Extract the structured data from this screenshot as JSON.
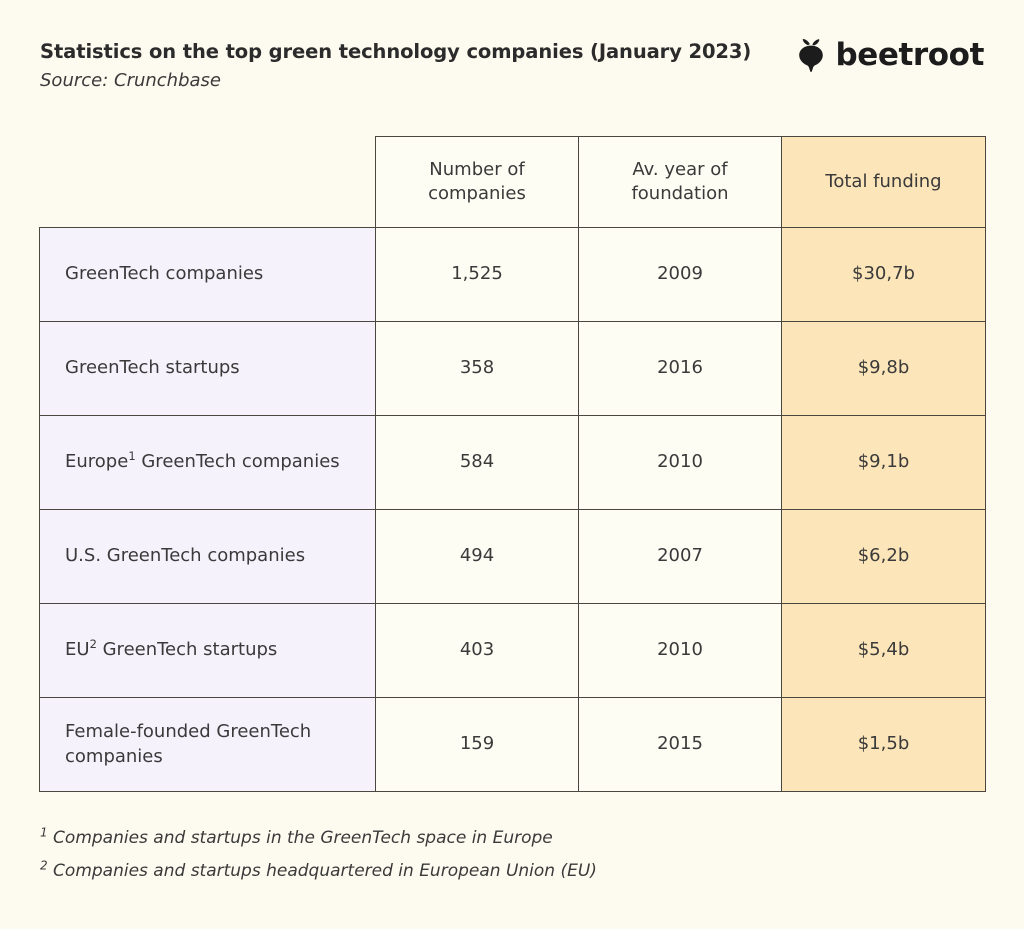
{
  "header": {
    "title": "Statistics on the top green technology companies (January 2023)",
    "source": "Source: Crunchbase",
    "logo": {
      "icon": "beetroot-icon",
      "wordmark": "beetroot"
    }
  },
  "colors": {
    "page_background": "#fdfaef",
    "label_column": "#f5f2fc",
    "data_column": "#fefdf4",
    "highlight_column": "#fce5b8",
    "border": "#4a4640",
    "text": "#3a3a3a"
  },
  "chart_data": {
    "type": "table",
    "title": "Statistics on the top green technology companies (January 2023)",
    "subtitle": "Source: Crunchbase",
    "columns": [
      "",
      "Number of companies",
      "Av. year of foundation",
      "Total funding"
    ],
    "column_headers_display": [
      {
        "line1": "Number of",
        "line2": "companies"
      },
      {
        "line1": "Av. year of",
        "line2": "foundation"
      },
      {
        "line1": "Total funding",
        "line2": ""
      }
    ],
    "rows": [
      {
        "label": "GreenTech companies",
        "label_prefix": "GreenTech companies",
        "footnote_mark": "",
        "label_suffix": "",
        "companies": "1,525",
        "year": "2009",
        "funding": "$30,7b"
      },
      {
        "label": "GreenTech startups",
        "label_prefix": "GreenTech startups",
        "footnote_mark": "",
        "label_suffix": "",
        "companies": "358",
        "year": "2016",
        "funding": "$9,8b"
      },
      {
        "label": "Europe¹ GreenTech companies",
        "label_prefix": "Europe",
        "footnote_mark": "1",
        "label_suffix": " GreenTech companies",
        "companies": "584",
        "year": "2010",
        "funding": "$9,1b"
      },
      {
        "label": "U.S. GreenTech companies",
        "label_prefix": "U.S. GreenTech companies",
        "footnote_mark": "",
        "label_suffix": "",
        "companies": "494",
        "year": "2007",
        "funding": "$6,2b"
      },
      {
        "label": "EU² GreenTech startups",
        "label_prefix": "EU",
        "footnote_mark": "2",
        "label_suffix": " GreenTech startups",
        "companies": "403",
        "year": "2010",
        "funding": "$5,4b"
      },
      {
        "label": "Female-founded GreenTech companies",
        "label_prefix": "Female-founded GreenTech companies",
        "footnote_mark": "",
        "label_suffix": "",
        "companies": "159",
        "year": "2015",
        "funding": "$1,5b"
      }
    ],
    "highlighted_column": "Total funding"
  },
  "footnotes": [
    {
      "mark": "1",
      "text": "Companies and startups in the GreenTech space in Europe"
    },
    {
      "mark": "2",
      "text": "Companies and startups headquartered in European Union (EU)"
    }
  ]
}
